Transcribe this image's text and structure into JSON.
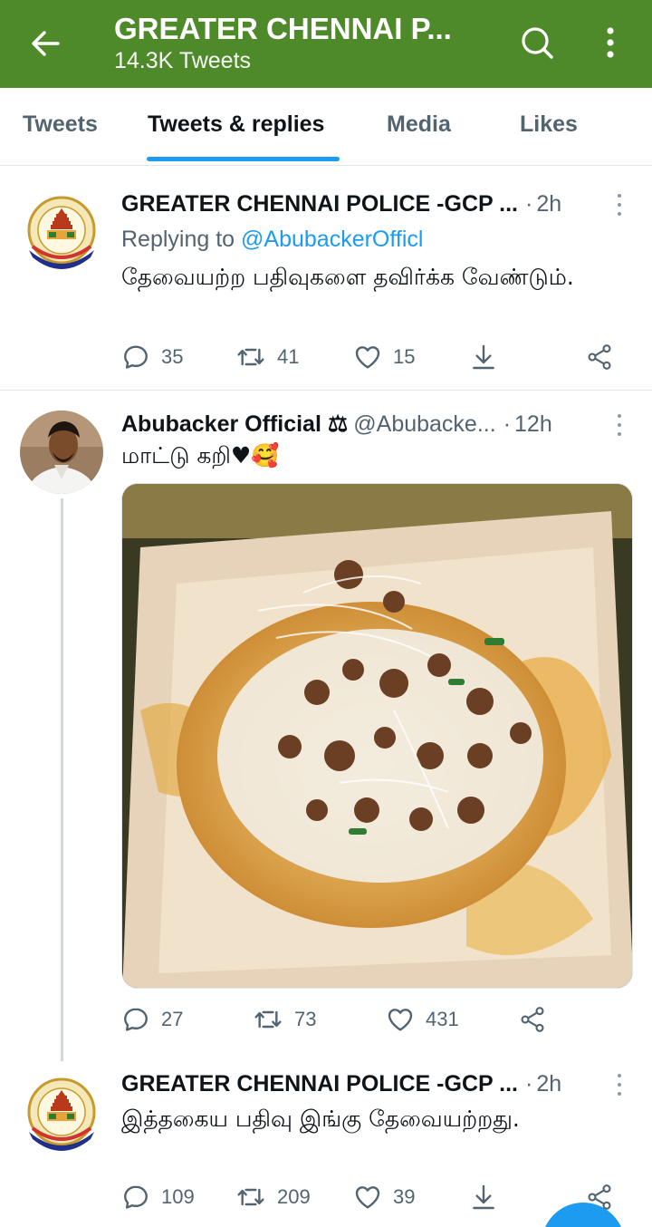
{
  "header": {
    "title": "GREATER CHENNAI P...",
    "subtitle": "14.3K Tweets"
  },
  "tabs": [
    {
      "label": "Tweets"
    },
    {
      "label": "Tweets & replies"
    },
    {
      "label": "Media"
    },
    {
      "label": "Likes"
    }
  ],
  "tweets": [
    {
      "name": "GREATER CHENNAI POLICE -GCP ...",
      "dot": "·",
      "time": "2h",
      "replying_prefix": "Replying to",
      "replying_to": "@AbubackerOfficl",
      "text": "தேவையற்ற பதிவுகளை தவிர்க்க வேண்டும்.",
      "replies": "35",
      "retweets": "41",
      "likes": "15"
    },
    {
      "name": "Abubacker Official ⚖",
      "handle": "@Abubacke...",
      "dot": "·",
      "time": "12h",
      "text": "மாட்டு கறி♥🥰",
      "replies": "27",
      "retweets": "73",
      "likes": "431"
    },
    {
      "name": "GREATER CHENNAI POLICE -GCP ...",
      "dot": "·",
      "time": "2h",
      "text": "இத்தகைய பதிவு இங்கு தேவையற்றது.",
      "replies": "109",
      "retweets": "209",
      "likes": "39"
    }
  ],
  "colors": {
    "header_bg": "#4f8a2a",
    "accent": "#1d9bf0",
    "muted": "#536471"
  }
}
